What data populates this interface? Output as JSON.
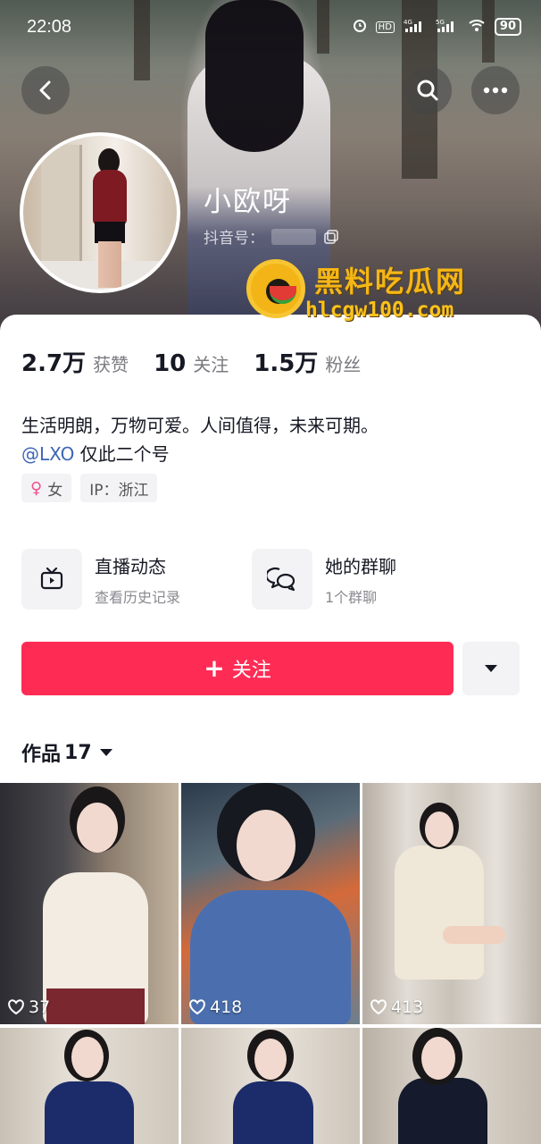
{
  "status_bar": {
    "time": "22:08",
    "icons": [
      "alarm-icon",
      "hd-icon",
      "4g-signal-icon",
      "5g-signal-icon",
      "wifi-icon"
    ],
    "battery": "90"
  },
  "header": {
    "back_icon": "chevron-left-icon",
    "search_icon": "search-icon",
    "more_icon": "more-dots-icon"
  },
  "profile": {
    "nickname": "小欧呀",
    "douyin_id_label": "抖音号：",
    "copy_icon": "copy-icon"
  },
  "watermark": {
    "title": "黑料吃瓜网",
    "url": "hlcgw100.com"
  },
  "stats": [
    {
      "value": "2.7万",
      "label": "获赞"
    },
    {
      "value": "10",
      "label": "关注"
    },
    {
      "value": "1.5万",
      "label": "粉丝"
    }
  ],
  "bio": {
    "line1": "生活明朗，万物可爱。人间值得，未来可期。",
    "mention": "@LXO",
    "line2_rest": " 仅此二个号"
  },
  "tags": {
    "gender_symbol": "♀",
    "gender": "女",
    "ip": "IP：浙江"
  },
  "entries": {
    "live": {
      "title": "直播动态",
      "subtitle": "查看历史记录",
      "icon": "tv-icon"
    },
    "group": {
      "title": "她的群聊",
      "subtitle": "1个群聊",
      "icon": "chat-bubbles-icon"
    }
  },
  "actions": {
    "follow_label": "关注",
    "follow_plus": "+",
    "more_icon": "caret-down-icon"
  },
  "works": {
    "label": "作品",
    "count": "17",
    "caret_icon": "caret-down-icon",
    "items": [
      {
        "likes": "37"
      },
      {
        "likes": "418"
      },
      {
        "likes": "413"
      },
      {
        "likes": ""
      },
      {
        "likes": ""
      },
      {
        "likes": ""
      }
    ]
  },
  "colors": {
    "accent": "#fe2c55",
    "mention": "#3d66b4",
    "watermark": "#f5b717"
  }
}
